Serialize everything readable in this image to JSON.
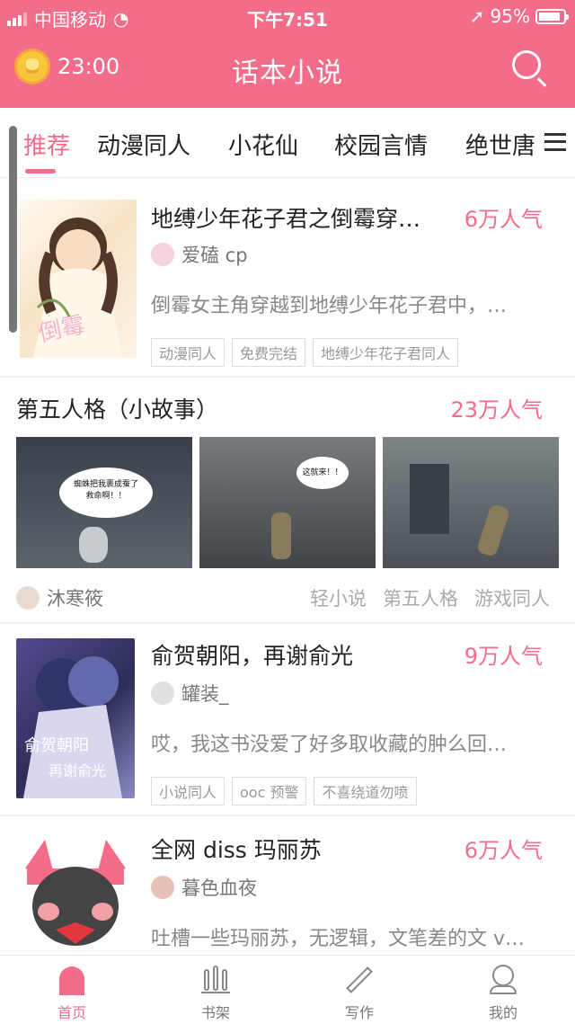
{
  "status_bar": {
    "carrier": "中国移动",
    "time": "下午7:51",
    "battery": "95%",
    "battery_level": 0.95
  },
  "header": {
    "timer": "23:00",
    "title": "话本小说",
    "alarm_icon": "alarm-coin-icon",
    "search_icon": "search-icon"
  },
  "tabs": [
    {
      "label": "推荐",
      "active": true
    },
    {
      "label": "动漫同人",
      "active": false
    },
    {
      "label": "小花仙",
      "active": false
    },
    {
      "label": "校园言情",
      "active": false
    },
    {
      "label": "绝世唐",
      "active": false
    }
  ],
  "cards": [
    {
      "title": "地缚少年花子君之倒霉穿…",
      "popularity": "6万人气",
      "author": "爱磕 cp",
      "description": "倒霉女主角穿越到地缚少年花子君中，…",
      "tags": [
        "动漫同人",
        "免费完结",
        "地缚少年花子君同人"
      ]
    },
    {
      "title": "第五人格（小故事）",
      "popularity": "23万人气",
      "author": "沐寒筱",
      "tags": [
        "轻小说",
        "第五人格",
        "游戏同人"
      ],
      "speech": [
        "蜘蛛把我裹成蚕了",
        "救命啊！！",
        "这就来！！"
      ]
    },
    {
      "title": "俞贺朝阳，再谢俞光",
      "popularity": "9万人气",
      "author": "罐装_",
      "description": "哎，我这书没爱了好多取收藏的肿么回…",
      "tags": [
        "小说同人",
        "ooc 预警",
        "不喜绕道勿喷"
      ]
    },
    {
      "title": "全网 diss 玛丽苏",
      "popularity": "6万人气",
      "author": "暮色血夜",
      "description": "吐槽一些玛丽苏，无逻辑，文笔差的文 v…"
    }
  ],
  "bottom_nav": [
    {
      "label": "首页",
      "icon": "home-icon",
      "active": true
    },
    {
      "label": "书架",
      "icon": "bookshelf-icon",
      "active": false
    },
    {
      "label": "写作",
      "icon": "pen-icon",
      "active": false
    },
    {
      "label": "我的",
      "icon": "profile-icon",
      "active": false
    }
  ],
  "colors": {
    "accent": "#f36d8a",
    "text": "#222222",
    "muted": "#888888"
  }
}
